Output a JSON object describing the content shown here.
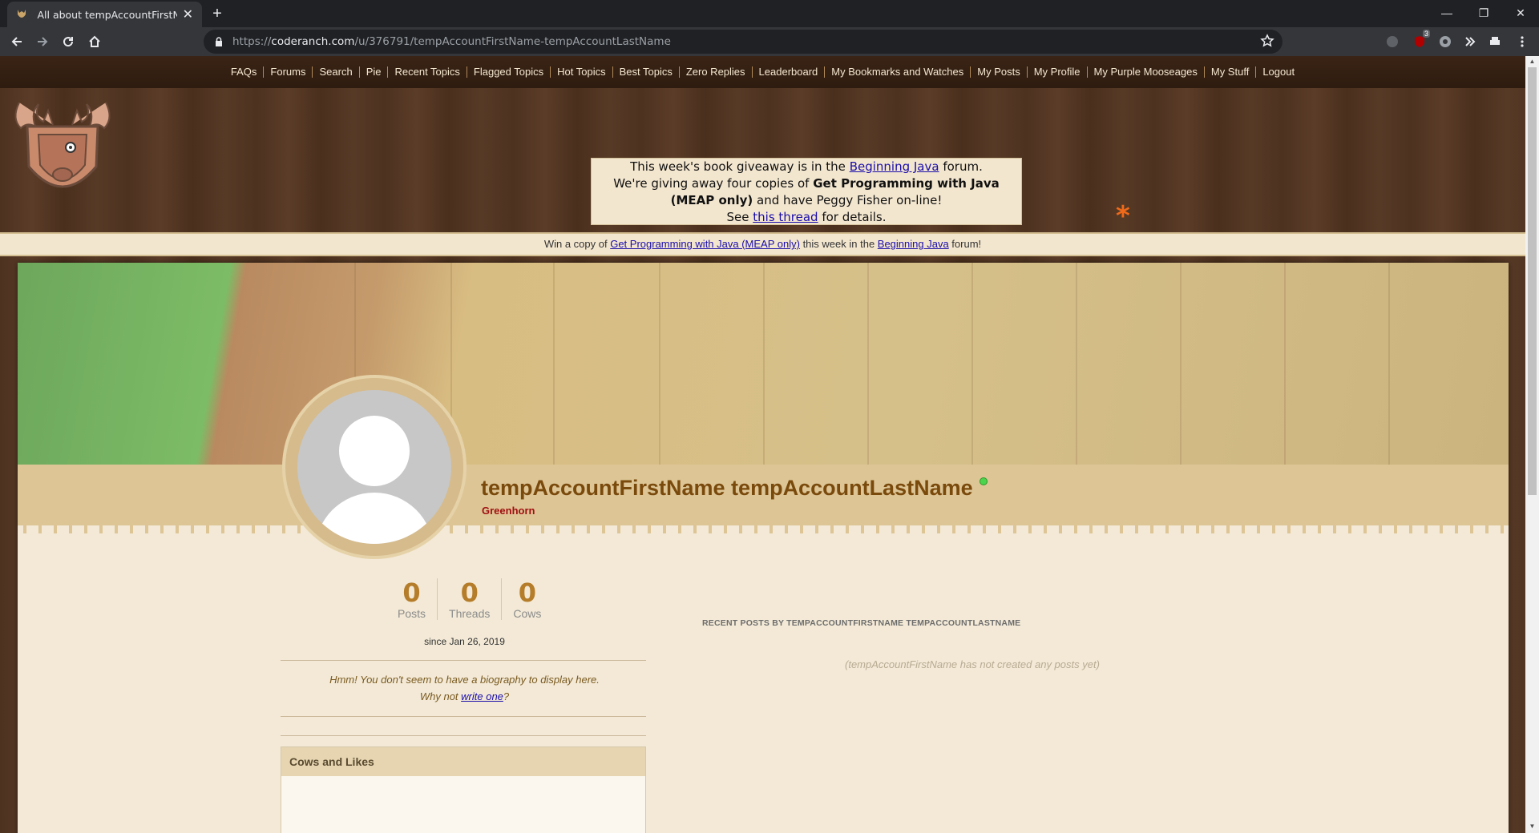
{
  "browser": {
    "tab_title": "All about tempAccountFirstName tempAccountLastName",
    "url_prefix": "https://",
    "url_domain": "coderanch.com",
    "url_path": "/u/376791/tempAccountFirstName-tempAccountLastName",
    "extension_badge": "3"
  },
  "nav": {
    "items": [
      "FAQs",
      "Forums",
      "Search",
      "Pie",
      "Recent Topics",
      "Flagged Topics",
      "Hot Topics",
      "Best Topics",
      "Zero Replies",
      "Leaderboard",
      "My Bookmarks and Watches",
      "My Posts",
      "My Profile",
      "My Purple Mooseages",
      "My Stuff",
      "Logout"
    ]
  },
  "promo": {
    "line1_pre": "This week's book giveaway is in the ",
    "line1_link": "Beginning Java",
    "line1_post": " forum.",
    "line2_pre": "We're giving away four copies of ",
    "line2_bold": "Get Programming with Java (MEAP only)",
    "line2_post": " and have Peggy Fisher on-line!",
    "line3_pre": "See ",
    "line3_link": "this thread",
    "line3_post": " for details.",
    "asterisk": "*"
  },
  "winbar": {
    "pre": "Win a copy of ",
    "book_link": "Get Programming with Java (MEAP only)",
    "mid": " this week in the ",
    "forum_link": "Beginning Java",
    "post": " forum!"
  },
  "profile": {
    "full_name": "tempAccountFirstName tempAccountLastName",
    "rank": "Greenhorn",
    "stats": [
      {
        "value": "0",
        "label": "Posts"
      },
      {
        "value": "0",
        "label": "Threads"
      },
      {
        "value": "0",
        "label": "Cows"
      }
    ],
    "since": "since Jan 26, 2019",
    "bio_line1": "Hmm! You don't seem to have a biography to display here.",
    "bio_line2_pre": "Why not ",
    "bio_link": "write one",
    "bio_line2_post": "?",
    "cows_title": "Cows and Likes",
    "recent_title": "RECENT POSTS BY TEMPACCOUNTFIRSTNAME TEMPACCOUNTLASTNAME",
    "no_posts": "(tempAccountFirstName has not created any posts yet)"
  },
  "colors": {
    "nav_bg": "#2e1c10",
    "name_color": "#7a4a0c",
    "rank_color": "#a01010",
    "stat_color": "#b57d2a",
    "online": "#4cd44c"
  }
}
